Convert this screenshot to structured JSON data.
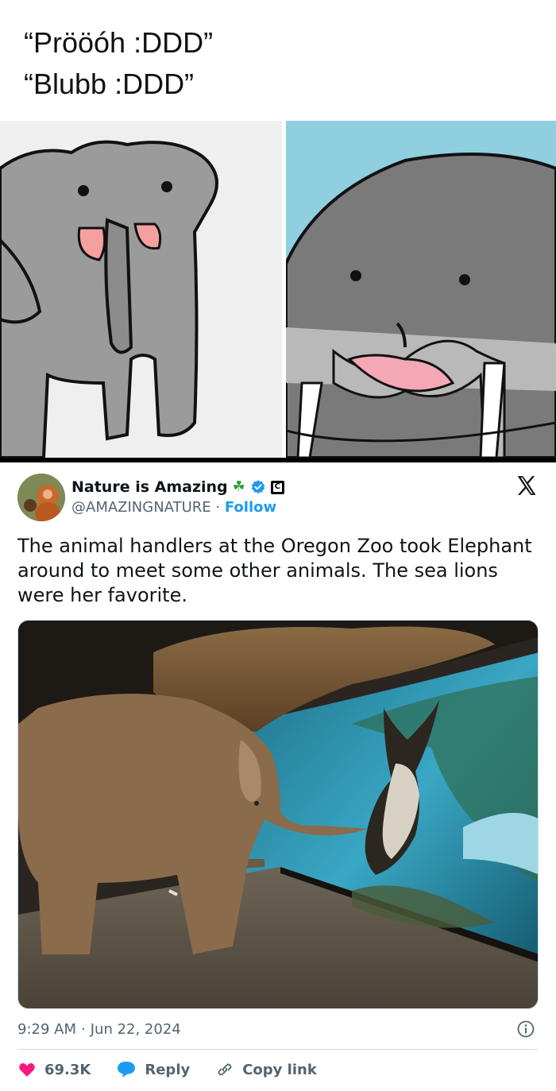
{
  "meme": {
    "lines": [
      "“Prööóh :DDD”",
      "“Blubb :DDD”"
    ]
  },
  "tweet": {
    "author": {
      "display_name": "Nature is Amazing",
      "name_emoji": "☘",
      "handle": "@AMAZINGNATURE",
      "separator": "·",
      "follow_label": "Follow",
      "badge_letter": "C"
    },
    "text": "The animal handlers at the Oregon Zoo took Elephant around to meet some other animals. The sea lions were her favorite.",
    "time": "9:29 AM",
    "meta_separator": "·",
    "date": "Jun 22, 2024",
    "actions": {
      "likes": "69.3K",
      "reply_label": "Reply",
      "copy_label": "Copy link"
    }
  },
  "colors": {
    "accent": "#1d9bf0",
    "like": "#f91880",
    "muted": "#536471"
  },
  "icons": [
    "clover-icon",
    "verified-icon",
    "c-badge-icon",
    "x-logo-icon",
    "info-icon",
    "heart-icon",
    "reply-bubble-icon",
    "link-icon"
  ]
}
